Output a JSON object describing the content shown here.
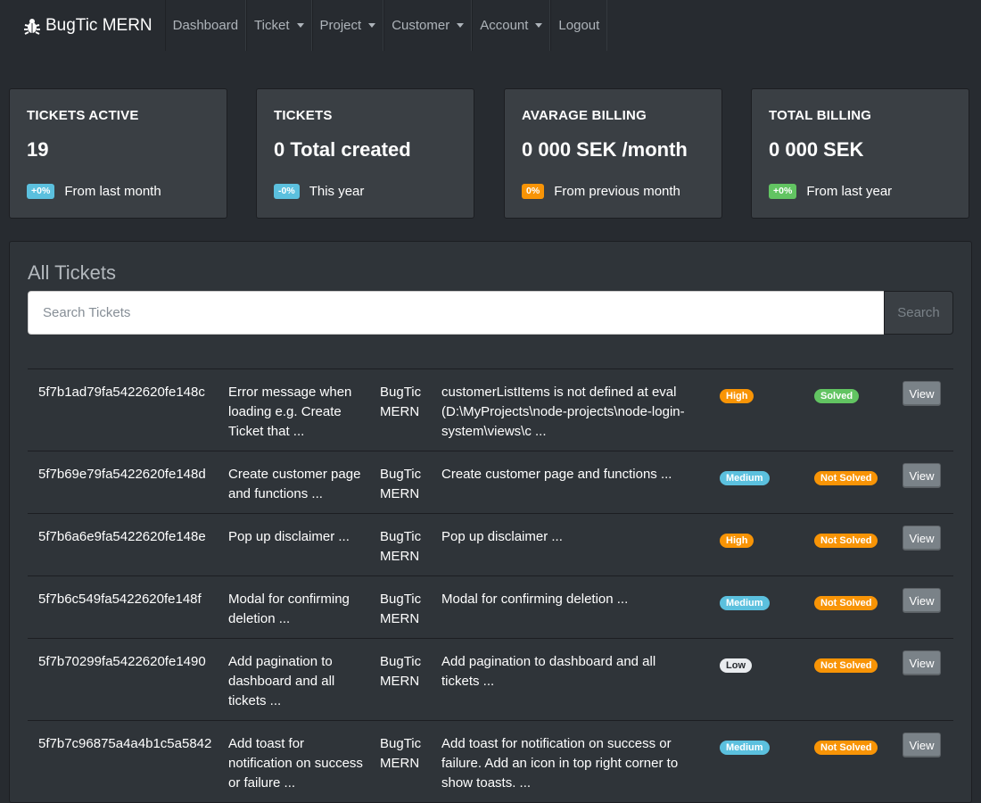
{
  "navbar": {
    "brand": "BugTic MERN",
    "brand_icon": "bug-icon",
    "items": [
      {
        "label": "Dashboard",
        "dropdown": false
      },
      {
        "label": "Ticket",
        "dropdown": true
      },
      {
        "label": "Project",
        "dropdown": true
      },
      {
        "label": "Customer",
        "dropdown": true
      },
      {
        "label": "Account",
        "dropdown": true
      },
      {
        "label": "Logout",
        "dropdown": false
      }
    ]
  },
  "stats": [
    {
      "title": "TICKETS ACTIVE",
      "value": "19",
      "badge": "+0%",
      "badge_color": "#5bc0de",
      "caption": "From last month"
    },
    {
      "title": "TICKETS",
      "value": "0 Total created",
      "badge": "-0%",
      "badge_color": "#5bc0de",
      "caption": "This year"
    },
    {
      "title": "AVARAGE BILLING",
      "value": "0 000 SEK /month",
      "badge": "0%",
      "badge_color": "#f89406",
      "caption": "From previous month"
    },
    {
      "title": "TOTAL BILLING",
      "value": "0 000 SEK",
      "badge": "+0%",
      "badge_color": "#62c462",
      "caption": "From last year"
    }
  ],
  "tickets": {
    "title": "All Tickets",
    "search_placeholder": "Search Tickets",
    "search_button": "Search",
    "view_label": "View",
    "rows": [
      {
        "id": "5f7b1ad79fa5422620fe148c",
        "title": "Error message when loading e.g. Create Ticket that ...",
        "project": "BugTic MERN",
        "description": "customerListItems is not defined at eval (D:\\MyProjects\\node-projects\\node-login-system\\views\\c ...",
        "priority": "High",
        "status": "Solved"
      },
      {
        "id": "5f7b69e79fa5422620fe148d",
        "title": "Create customer page and functions ...",
        "project": "BugTic MERN",
        "description": "Create customer page and functions ...",
        "priority": "Medium",
        "status": "Not Solved"
      },
      {
        "id": "5f7b6a6e9fa5422620fe148e",
        "title": "Pop up disclaimer ...",
        "project": "BugTic MERN",
        "description": "Pop up disclaimer ...",
        "priority": "High",
        "status": "Not Solved"
      },
      {
        "id": "5f7b6c549fa5422620fe148f",
        "title": "Modal for confirming deletion ...",
        "project": "BugTic MERN",
        "description": "Modal for confirming deletion ...",
        "priority": "Medium",
        "status": "Not Solved"
      },
      {
        "id": "5f7b70299fa5422620fe1490",
        "title": "Add pagination to dashboard and all tickets ...",
        "project": "BugTic MERN",
        "description": "Add pagination to dashboard and all tickets ...",
        "priority": "Low",
        "status": "Not Solved"
      },
      {
        "id": "5f7b7c96875a4a4b1c5a5842",
        "title": "Add toast for notification on success or failure ...",
        "project": "BugTic MERN",
        "description": "Add toast for notification on success or failure. Add an icon in top right corner to show toasts. ...",
        "priority": "Medium",
        "status": "Not Solved"
      }
    ]
  }
}
